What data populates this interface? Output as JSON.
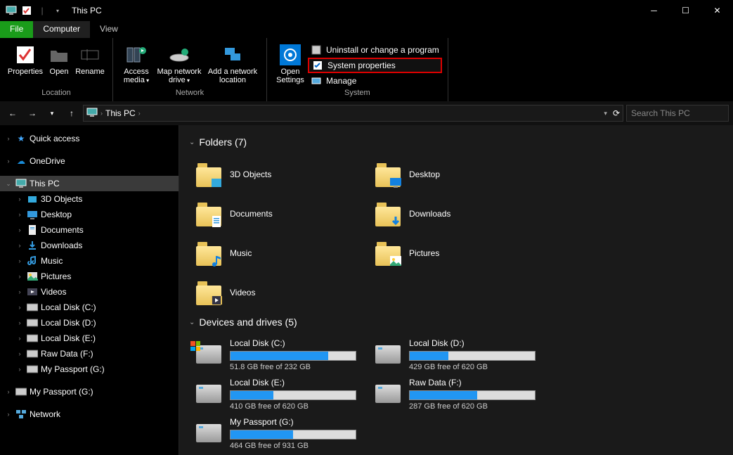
{
  "window": {
    "title": "This PC"
  },
  "tabs": {
    "file": "File",
    "computer": "Computer",
    "view": "View"
  },
  "ribbon": {
    "location": {
      "label": "Location",
      "properties": "Properties",
      "open": "Open",
      "rename": "Rename"
    },
    "network": {
      "label": "Network",
      "access_media": "Access media",
      "map_drive": "Map network drive",
      "add_loc": "Add a network location"
    },
    "system": {
      "label": "System",
      "open_settings": "Open Settings",
      "uninstall": "Uninstall or change a program",
      "sysprops": "System properties",
      "manage": "Manage"
    }
  },
  "address": {
    "crumb1": "This PC",
    "search_placeholder": "Search This PC"
  },
  "tree": {
    "quick": "Quick access",
    "onedrive": "OneDrive",
    "thispc": "This PC",
    "items": [
      "3D Objects",
      "Desktop",
      "Documents",
      "Downloads",
      "Music",
      "Pictures",
      "Videos",
      "Local Disk (C:)",
      "Local Disk (D:)",
      "Local Disk (E:)",
      "Raw Data (F:)",
      "My Passport (G:)"
    ],
    "mypassport2": "My Passport (G:)",
    "network": "Network"
  },
  "sections": {
    "folders": "Folders (7)",
    "drives": "Devices and drives (5)"
  },
  "folders": [
    "3D Objects",
    "Desktop",
    "Documents",
    "Downloads",
    "Music",
    "Pictures",
    "Videos"
  ],
  "drives": [
    {
      "name": "Local Disk (C:)",
      "free": "51.8 GB free of 232 GB",
      "pct": 78
    },
    {
      "name": "Local Disk (D:)",
      "free": "429 GB free of 620 GB",
      "pct": 31
    },
    {
      "name": "Local Disk (E:)",
      "free": "410 GB free of 620 GB",
      "pct": 34
    },
    {
      "name": "Raw Data (F:)",
      "free": "287 GB free of 620 GB",
      "pct": 54
    },
    {
      "name": "My Passport (G:)",
      "free": "464 GB free of 931 GB",
      "pct": 50
    }
  ]
}
